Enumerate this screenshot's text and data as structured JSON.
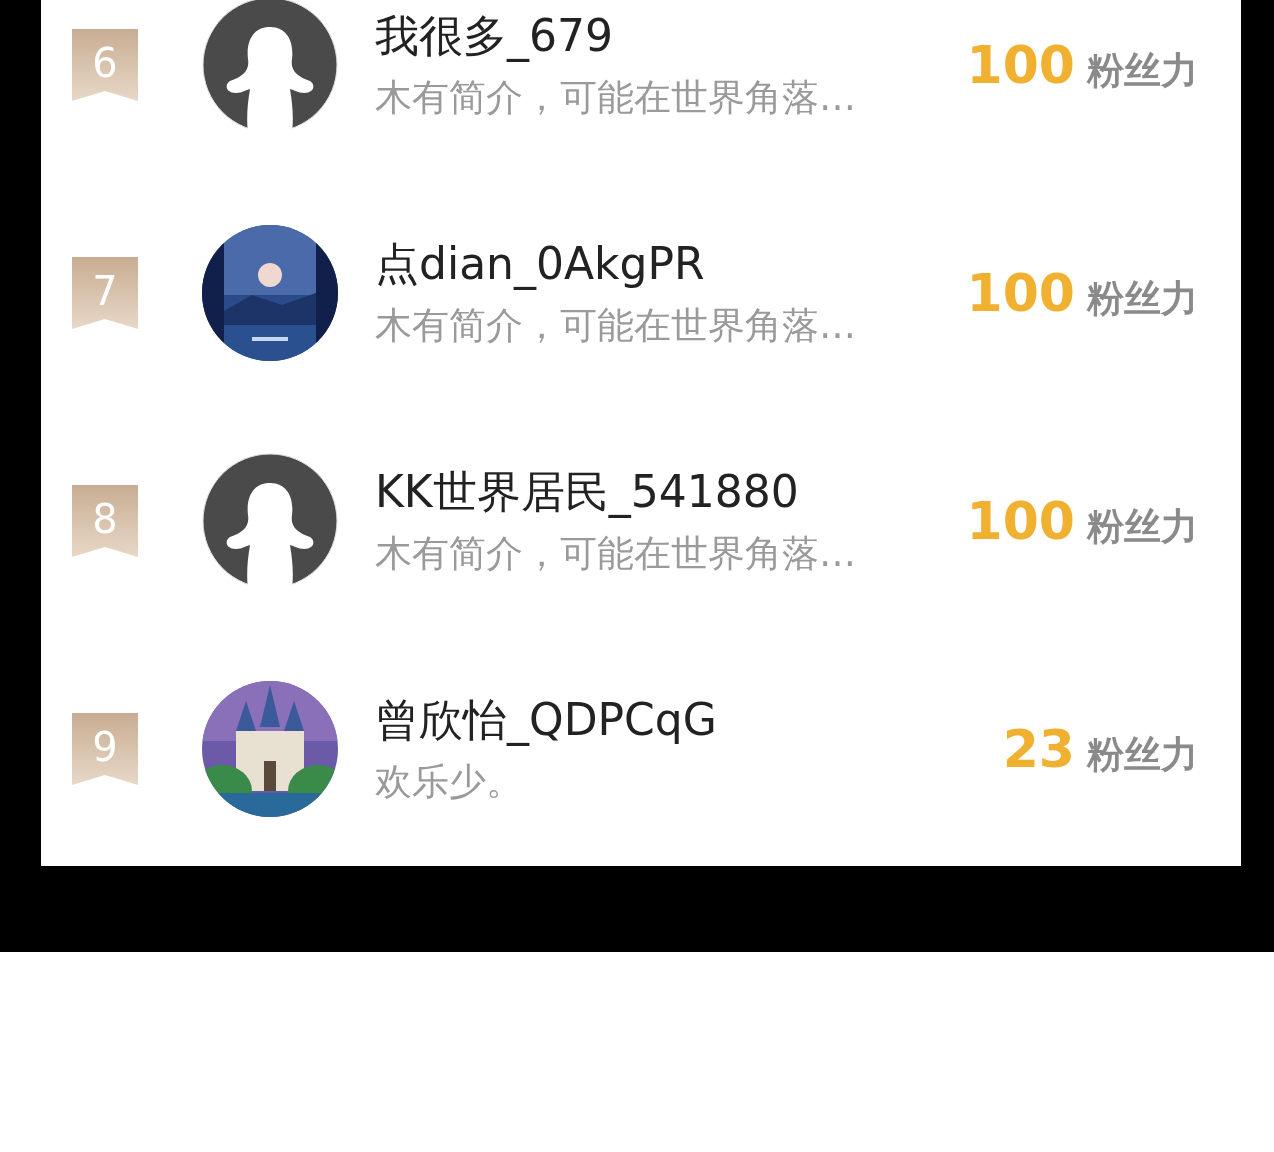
{
  "ranking": [
    {
      "rank": "6",
      "name": "我很多_679",
      "bio": "木有简介，可能在世界角落…",
      "score": "100",
      "unit": "粉丝力",
      "avatar": {
        "kind": "default"
      }
    },
    {
      "rank": "7",
      "name": "点dian_0AkgPR",
      "bio": "木有简介，可能在世界角落…",
      "score": "100",
      "unit": "粉丝力",
      "avatar": {
        "kind": "moon"
      }
    },
    {
      "rank": "8",
      "name": "KK世界居民_541880",
      "bio": "木有简介，可能在世界角落…",
      "score": "100",
      "unit": "粉丝力",
      "avatar": {
        "kind": "default"
      }
    },
    {
      "rank": "9",
      "name": "曾欣怡_QDPCqG",
      "bio": "欢乐少。",
      "score": "23",
      "unit": "粉丝力",
      "avatar": {
        "kind": "castle"
      }
    }
  ]
}
